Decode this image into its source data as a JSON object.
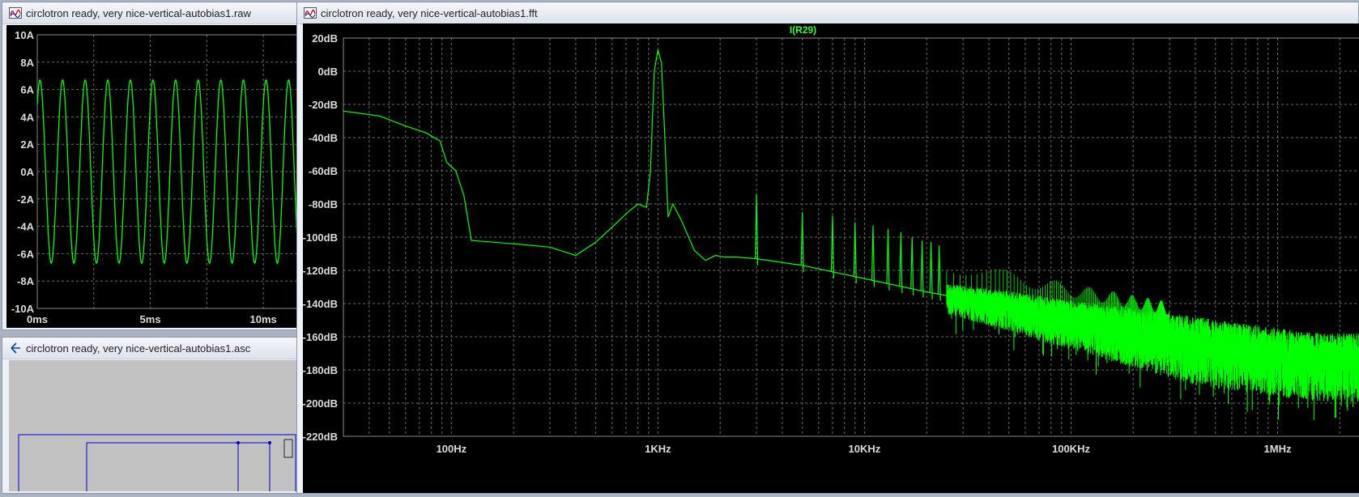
{
  "windows": {
    "raw": {
      "title": "circlotron ready, very nice-vertical-autobias1.raw"
    },
    "asc": {
      "title": "circlotron ready, very nice-vertical-autobias1.asc"
    },
    "fft": {
      "title": "circlotron ready, very nice-vertical-autobias1.fft",
      "trace_label": "I(R29)"
    }
  },
  "colors": {
    "trace": "#00ff00",
    "label_trace": "#33ff33",
    "background": "#000000",
    "grid": "#6a6a6a",
    "schematic_wire": "#0000cc"
  },
  "icons": {
    "raw": "waveform-icon",
    "asc": "schematic-icon",
    "fft": "waveform-icon"
  },
  "chart_data": [
    {
      "type": "line",
      "window": "raw",
      "title": "",
      "xlabel": "",
      "ylabel": "",
      "y_ticks": [
        "10A",
        "8A",
        "6A",
        "4A",
        "2A",
        "0A",
        "-2A",
        "-4A",
        "-6A",
        "-8A",
        "-10A"
      ],
      "x_ticks": [
        "0ms",
        "5ms",
        "10ms"
      ],
      "ylim": [
        -10,
        10
      ],
      "xlim_ms": [
        0,
        11.5
      ],
      "grid": true,
      "series": [
        {
          "shape": "sine",
          "amplitude_A": 6.7,
          "frequency_Hz": 1000,
          "phase_start": 0.13
        }
      ]
    },
    {
      "type": "line",
      "window": "fft",
      "title": "I(R29)",
      "xscale": "log",
      "y_ticks": [
        "20dB",
        "0dB",
        "-20dB",
        "-40dB",
        "-60dB",
        "-80dB",
        "-100dB",
        "-120dB",
        "-140dB",
        "-160dB",
        "-180dB",
        "-200dB",
        "-220dB"
      ],
      "x_ticks": [
        "100Hz",
        "1KHz",
        "10KHz",
        "100KHz",
        "1MHz"
      ],
      "ylim": [
        -220,
        20
      ],
      "xlim_Hz": [
        30,
        2500000
      ],
      "grid": true,
      "series": [
        {
          "points": [
            [
              30,
              -24
            ],
            [
              45,
              -27
            ],
            [
              60,
              -33
            ],
            [
              75,
              -37
            ],
            [
              88,
              -42
            ],
            [
              95,
              -55
            ],
            [
              105,
              -60
            ],
            [
              115,
              -75
            ],
            [
              125,
              -102
            ],
            [
              200,
              -104
            ],
            [
              300,
              -106
            ],
            [
              400,
              -111
            ],
            [
              500,
              -103
            ],
            [
              600,
              -94
            ],
            [
              700,
              -86
            ],
            [
              800,
              -80
            ],
            [
              880,
              -82
            ],
            [
              920,
              -60
            ],
            [
              960,
              0
            ],
            [
              1000,
              13
            ],
            [
              1040,
              5
            ],
            [
              1080,
              -40
            ],
            [
              1120,
              -88
            ],
            [
              1180,
              -80
            ],
            [
              1300,
              -90
            ],
            [
              1500,
              -108
            ],
            [
              1700,
              -114
            ],
            [
              1900,
              -111
            ],
            [
              2100,
              -112
            ],
            [
              2400,
              -112
            ],
            [
              3000,
              -113
            ],
            [
              5000,
              -117
            ],
            [
              10000,
              -125
            ],
            [
              20000,
              -133
            ],
            [
              50000,
              -142
            ],
            [
              100000,
              -150
            ],
            [
              200000,
              -157
            ],
            [
              500000,
              -166
            ],
            [
              1000000,
              -171
            ],
            [
              1600000,
              -174
            ],
            [
              2500000,
              -174
            ]
          ],
          "harmonics": [
            [
              3000,
              -74
            ],
            [
              5000,
              -85
            ],
            [
              7000,
              -87
            ],
            [
              9000,
              -91
            ],
            [
              11000,
              -93
            ],
            [
              13000,
              -95
            ],
            [
              15000,
              -97
            ],
            [
              17000,
              -100
            ],
            [
              19000,
              -102
            ],
            [
              21000,
              -103
            ],
            [
              23000,
              -105
            ]
          ]
        }
      ]
    }
  ]
}
